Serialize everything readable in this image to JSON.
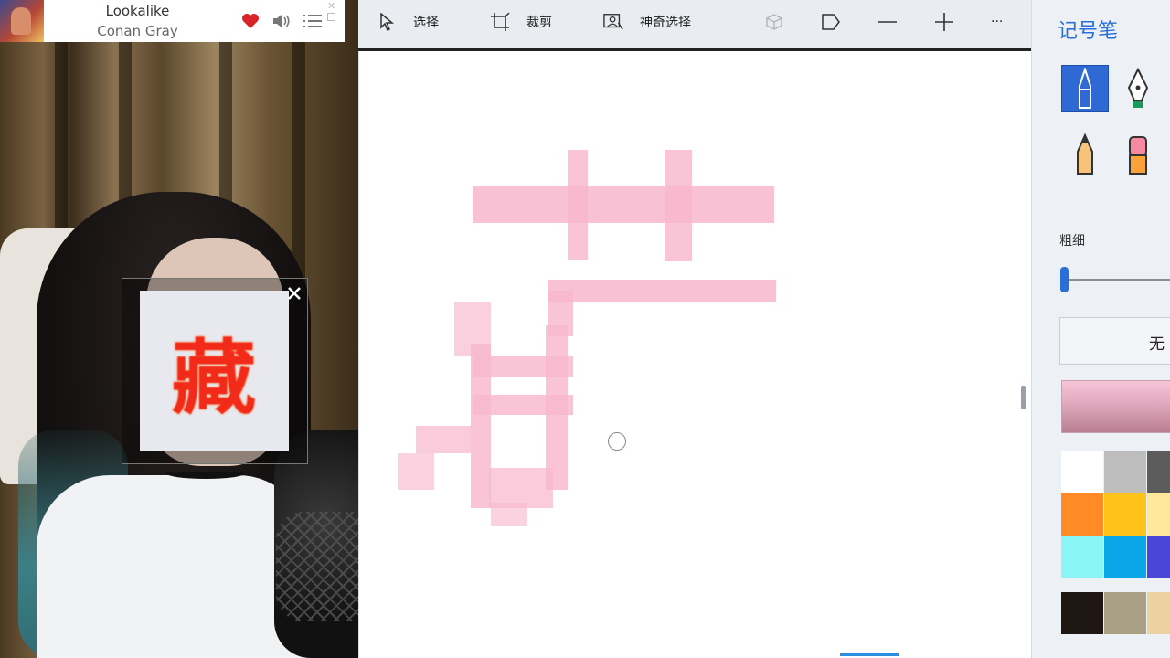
{
  "music_widget": {
    "title": "Lookalike",
    "artist": "Conan Gray",
    "like_icon": "heart-icon",
    "volume_icon": "volume-icon",
    "menu_icon": "menu-icon",
    "close_glyph": "✕"
  },
  "overlay": {
    "character": "藏",
    "close_glyph": "✕"
  },
  "toolbar": {
    "select_label": "选择",
    "crop_label": "裁剪",
    "magic_select_label": "神奇选择",
    "more_label": "···",
    "accent": "#2a6fd6"
  },
  "panel": {
    "title": "记号笔",
    "thickness_label": "粗细",
    "thickness_value": 0.02,
    "texture_label": "无",
    "selected_pen": "marker",
    "colors": [
      [
        "#ffffff",
        "#bdbdbd",
        "#5c5c5c"
      ],
      [
        "#ff8a26",
        "#ffc21a",
        "#ffe89a"
      ],
      [
        "#8af5f5",
        "#0aa6e8",
        "#4a46d6"
      ],
      [
        "#1f1812",
        "#a9a085",
        "#ecd29e"
      ]
    ],
    "stroke_color": "#f8b6cc"
  }
}
